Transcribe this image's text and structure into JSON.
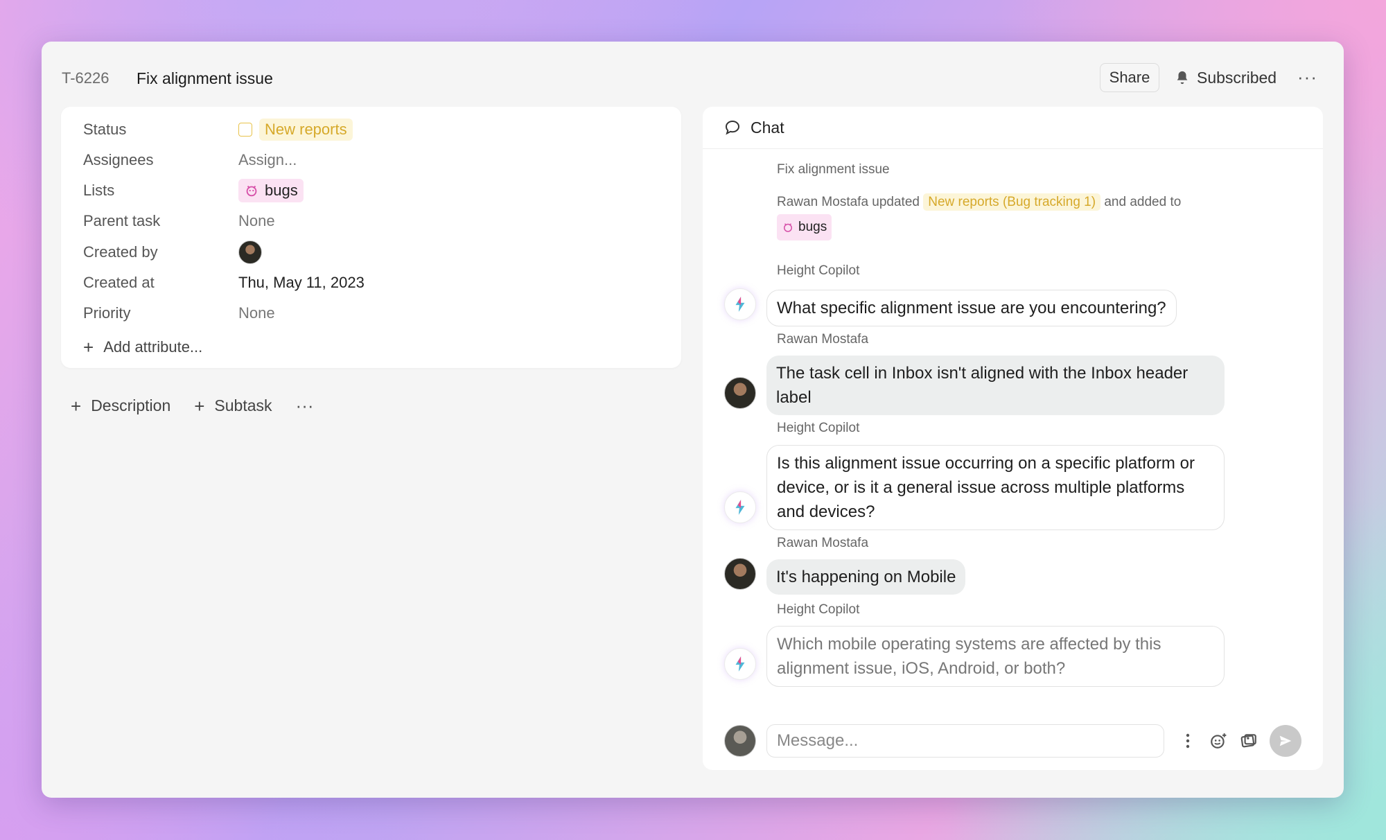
{
  "task": {
    "id": "T-6226",
    "title": "Fix alignment issue"
  },
  "header": {
    "share_label": "Share",
    "subscribed_label": "Subscribed"
  },
  "attributes": {
    "status_label": "Status",
    "status_value": "New reports",
    "assignees_label": "Assignees",
    "assignees_value": "Assign...",
    "lists_label": "Lists",
    "lists_value": "bugs",
    "parent_label": "Parent task",
    "parent_value": "None",
    "created_by_label": "Created by",
    "created_at_label": "Created at",
    "created_at_value": "Thu, May 11, 2023",
    "priority_label": "Priority",
    "priority_value": "None",
    "add_attribute": "Add attribute..."
  },
  "actions": {
    "description": "Description",
    "subtask": "Subtask"
  },
  "chat": {
    "title": "Chat",
    "system": {
      "title": "Fix alignment issue",
      "actor": "Rawan Mostafa updated",
      "status_tag": "New reports (Bug tracking 1)",
      "and_added": "and added",
      "to": "to",
      "list_tag": "bugs"
    },
    "messages": [
      {
        "sender": "Height Copilot",
        "text": "What specific alignment issue are you encountering?"
      },
      {
        "sender": "Rawan Mostafa",
        "text": "The task cell in Inbox isn't aligned with the Inbox header label"
      },
      {
        "sender": "Height Copilot",
        "text": "Is this alignment issue occurring on a specific platform or device, or is it a general issue across multiple platforms and devices?"
      },
      {
        "sender": "Rawan Mostafa",
        "text": "It's happening on Mobile"
      },
      {
        "sender": "Height Copilot",
        "text": "Which mobile operating systems are affected by this alignment issue, iOS, Android, or both?"
      }
    ],
    "composer_placeholder": "Message..."
  },
  "colors": {
    "status_yellow": "#d6a92a",
    "tag_pink": "#fbe2f3",
    "send_gray": "#c9c9c9"
  },
  "icons": [
    "bell-icon",
    "more-icon",
    "plus-icon",
    "chat-icon",
    "bug-icon",
    "copilot-icon",
    "kebab-icon",
    "emoji-icon",
    "attachment-icon",
    "send-icon"
  ]
}
